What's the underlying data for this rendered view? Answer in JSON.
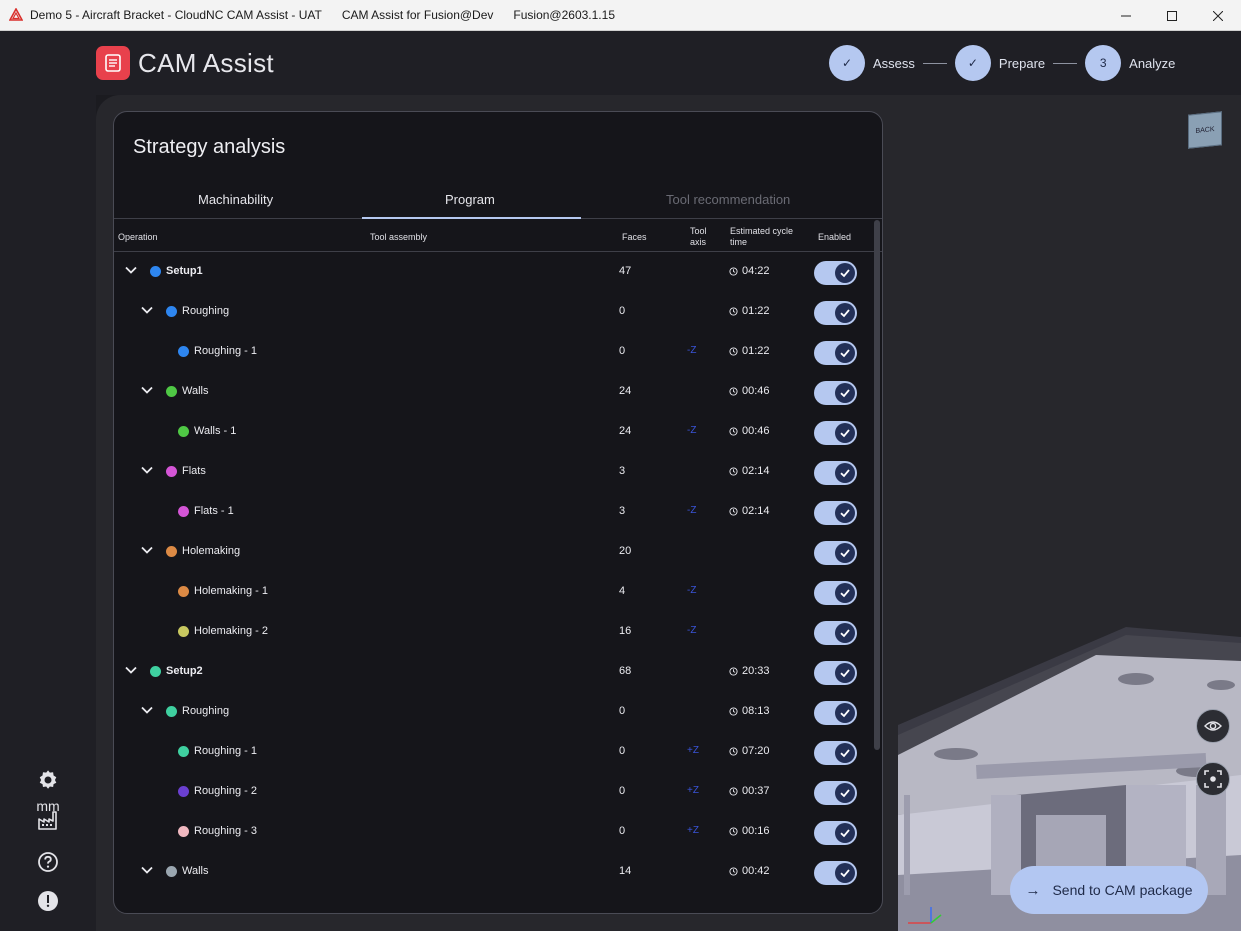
{
  "window": {
    "title_parts": [
      "Demo 5 - Aircraft Bracket - CloudNC CAM Assist - UAT",
      "CAM Assist for Fusion@Dev",
      "Fusion@2603.1.15"
    ]
  },
  "app": {
    "name": "CAM Assist",
    "brand_color": "#e8414c",
    "accent": "#b5c8f0"
  },
  "stepper": {
    "steps": [
      {
        "label": "Assess",
        "state": "done",
        "glyph": "✓"
      },
      {
        "label": "Prepare",
        "state": "done",
        "glyph": "✓"
      },
      {
        "label": "Analyze",
        "state": "current",
        "glyph": "3"
      }
    ]
  },
  "left_rail": {
    "unit": "mm",
    "icons": [
      "settings-icon",
      "factory-icon",
      "help-icon",
      "alert-icon"
    ]
  },
  "panel": {
    "title": "Strategy analysis",
    "tabs": [
      {
        "label": "Machinability",
        "active": false,
        "disabled": false
      },
      {
        "label": "Program",
        "active": true,
        "disabled": false
      },
      {
        "label": "Tool recommendation",
        "active": false,
        "disabled": true
      }
    ],
    "columns": {
      "operation": "Operation",
      "tool_assembly": "Tool assembly",
      "faces": "Faces",
      "tool_axis": "Tool axis",
      "cycle_time": "Estimated cycle time",
      "enabled": "Enabled"
    },
    "rows": [
      {
        "name": "Setup1",
        "level": 0,
        "expandable": true,
        "color": "#2e86f0",
        "faces": "47",
        "axis": "",
        "time": "04:22",
        "enabled": true
      },
      {
        "name": "Roughing",
        "level": 1,
        "expandable": true,
        "color": "#2e86f0",
        "faces": "0",
        "axis": "",
        "time": "01:22",
        "enabled": true
      },
      {
        "name": "Roughing - 1",
        "level": 2,
        "expandable": false,
        "color": "#2e86f0",
        "faces": "0",
        "axis": "-Z",
        "time": "01:22",
        "enabled": true
      },
      {
        "name": "Walls",
        "level": 1,
        "expandable": true,
        "color": "#4fc845",
        "faces": "24",
        "axis": "",
        "time": "00:46",
        "enabled": true
      },
      {
        "name": "Walls - 1",
        "level": 2,
        "expandable": false,
        "color": "#4fc845",
        "faces": "24",
        "axis": "-Z",
        "time": "00:46",
        "enabled": true
      },
      {
        "name": "Flats",
        "level": 1,
        "expandable": true,
        "color": "#d455d6",
        "faces": "3",
        "axis": "",
        "time": "02:14",
        "enabled": true
      },
      {
        "name": "Flats - 1",
        "level": 2,
        "expandable": false,
        "color": "#d455d6",
        "faces": "3",
        "axis": "-Z",
        "time": "02:14",
        "enabled": true
      },
      {
        "name": "Holemaking",
        "level": 1,
        "expandable": true,
        "color": "#dc8a45",
        "faces": "20",
        "axis": "",
        "time": "",
        "enabled": true
      },
      {
        "name": "Holemaking - 1",
        "level": 2,
        "expandable": false,
        "color": "#dc8a45",
        "faces": "4",
        "axis": "-Z",
        "time": "",
        "enabled": true
      },
      {
        "name": "Holemaking - 2",
        "level": 2,
        "expandable": false,
        "color": "#c8c860",
        "faces": "16",
        "axis": "-Z",
        "time": "",
        "enabled": true
      },
      {
        "name": "Setup2",
        "level": 0,
        "expandable": true,
        "color": "#3fd0a0",
        "faces": "68",
        "axis": "",
        "time": "20:33",
        "enabled": true
      },
      {
        "name": "Roughing",
        "level": 1,
        "expandable": true,
        "color": "#3fd0a0",
        "faces": "0",
        "axis": "",
        "time": "08:13",
        "enabled": true
      },
      {
        "name": "Roughing - 1",
        "level": 2,
        "expandable": false,
        "color": "#3fd0a0",
        "faces": "0",
        "axis": "+Z",
        "time": "07:20",
        "enabled": true
      },
      {
        "name": "Roughing - 2",
        "level": 2,
        "expandable": false,
        "color": "#6a3fd0",
        "faces": "0",
        "axis": "+Z",
        "time": "00:37",
        "enabled": true
      },
      {
        "name": "Roughing - 3",
        "level": 2,
        "expandable": false,
        "color": "#f0b8c0",
        "faces": "0",
        "axis": "+Z",
        "time": "00:16",
        "enabled": true
      },
      {
        "name": "Walls",
        "level": 1,
        "expandable": true,
        "color": "#9aa6b0",
        "faces": "14",
        "axis": "",
        "time": "00:42",
        "enabled": true
      }
    ]
  },
  "viewport": {
    "viewcube_label": "BACK",
    "send_button": "Send to CAM package"
  }
}
